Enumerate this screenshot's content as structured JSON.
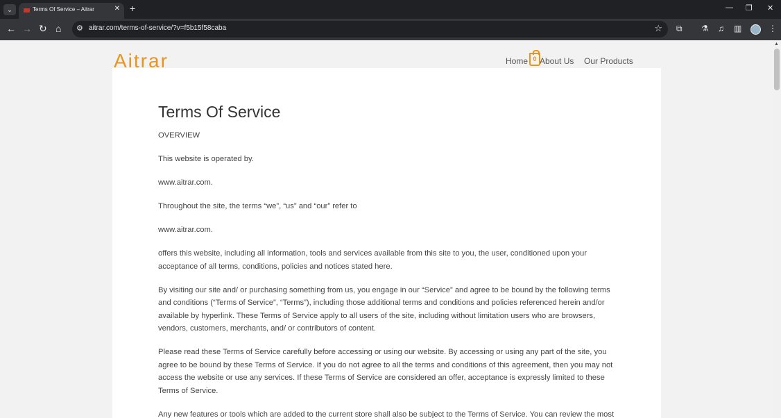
{
  "browser": {
    "tab_title": "Terms Of Service – Aitrar",
    "new_tab_symbol": "+",
    "url": "aitrar.com/terms-of-service/?v=f5b15f58caba"
  },
  "site": {
    "logo_text": "Aitrar",
    "nav": [
      {
        "label": "Home"
      },
      {
        "label": "About Us"
      },
      {
        "label": "Our Products"
      }
    ],
    "cart_count": "0",
    "accent_color": "#e8951e"
  },
  "page": {
    "title": "Terms Of Service",
    "paragraphs": [
      "OVERVIEW",
      "This website is operated by.",
      "www.aitrar.com.",
      "Throughout the site, the terms “we”, “us” and “our” refer to",
      "www.aitrar.com.",
      "offers this website, including all information, tools and services available from this site to you, the user, conditioned upon your acceptance of all terms, conditions, policies and notices stated here.",
      "By visiting our site and/ or purchasing something from us, you engage in our “Service” and agree to be bound by the following terms and conditions (“Terms of Service”, “Terms”), including those additional terms and conditions and policies referenced herein and/or available by hyperlink. These Terms of Service apply to all users of the site, including without limitation users who are browsers, vendors, customers, merchants, and/ or contributors of content.",
      "Please read these Terms of Service carefully before accessing or using our website. By accessing or using any part of the site, you agree to be bound by these Terms of Service. If you do not agree to all the terms and conditions of this agreement, then you may not access the website or use any services. If these Terms of Service are considered an offer, acceptance is expressly limited to these Terms of Service.",
      "Any new features or tools which are added to the current store shall also be subject to the Terms of Service. You can review the most"
    ]
  }
}
